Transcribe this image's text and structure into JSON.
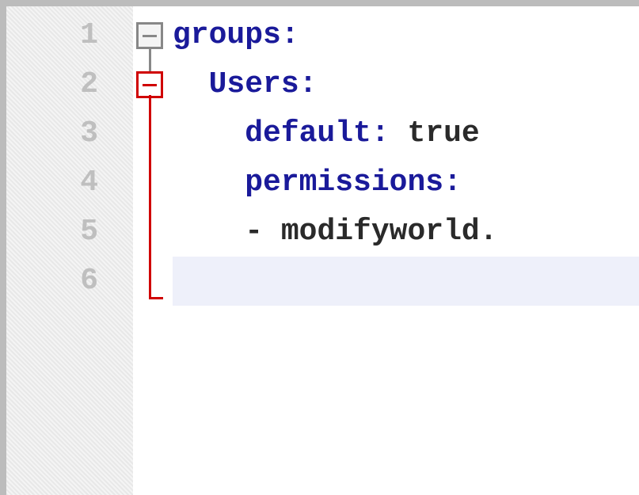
{
  "gutter": {
    "lines": [
      "1",
      "2",
      "3",
      "4",
      "5",
      "6"
    ]
  },
  "code": {
    "l1_key": "groups",
    "l2_key": "Users",
    "l3_key": "default",
    "l3_val": "true",
    "l4_key": "permissions",
    "l5_dash": "-",
    "l5_val": "modifyworld.",
    "colon": ":",
    "space": " "
  },
  "fold": {
    "box1_title": "collapse groups",
    "box2_title": "collapse Users"
  }
}
